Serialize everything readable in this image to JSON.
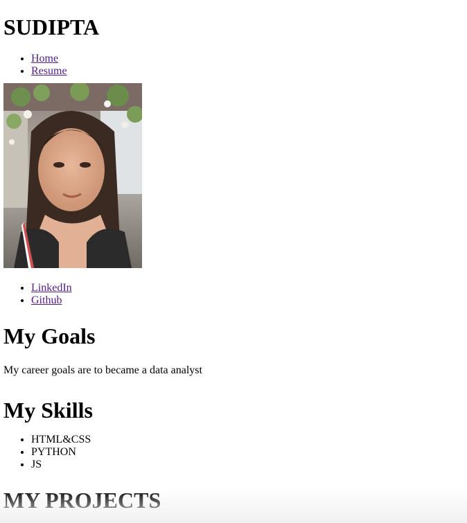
{
  "header": {
    "site_title": "SUDIPTA"
  },
  "nav": {
    "items": [
      {
        "label": "Home"
      },
      {
        "label": "Resume"
      }
    ]
  },
  "profile": {
    "image_icon": "portrait-photo"
  },
  "social": {
    "items": [
      {
        "label": "LinkedIn"
      },
      {
        "label": "Github"
      }
    ]
  },
  "goals": {
    "title": "My Goals",
    "text": "My career goals are to became a data analyst"
  },
  "skills": {
    "title": "My Skills",
    "items": [
      {
        "label": "HTML&CSS"
      },
      {
        "label": "PYTHON"
      },
      {
        "label": "JS"
      }
    ]
  },
  "projects": {
    "title": "MY PROJECTS"
  },
  "colors": {
    "link": "#551a8b",
    "text": "#000000",
    "background": "#ffffff"
  }
}
